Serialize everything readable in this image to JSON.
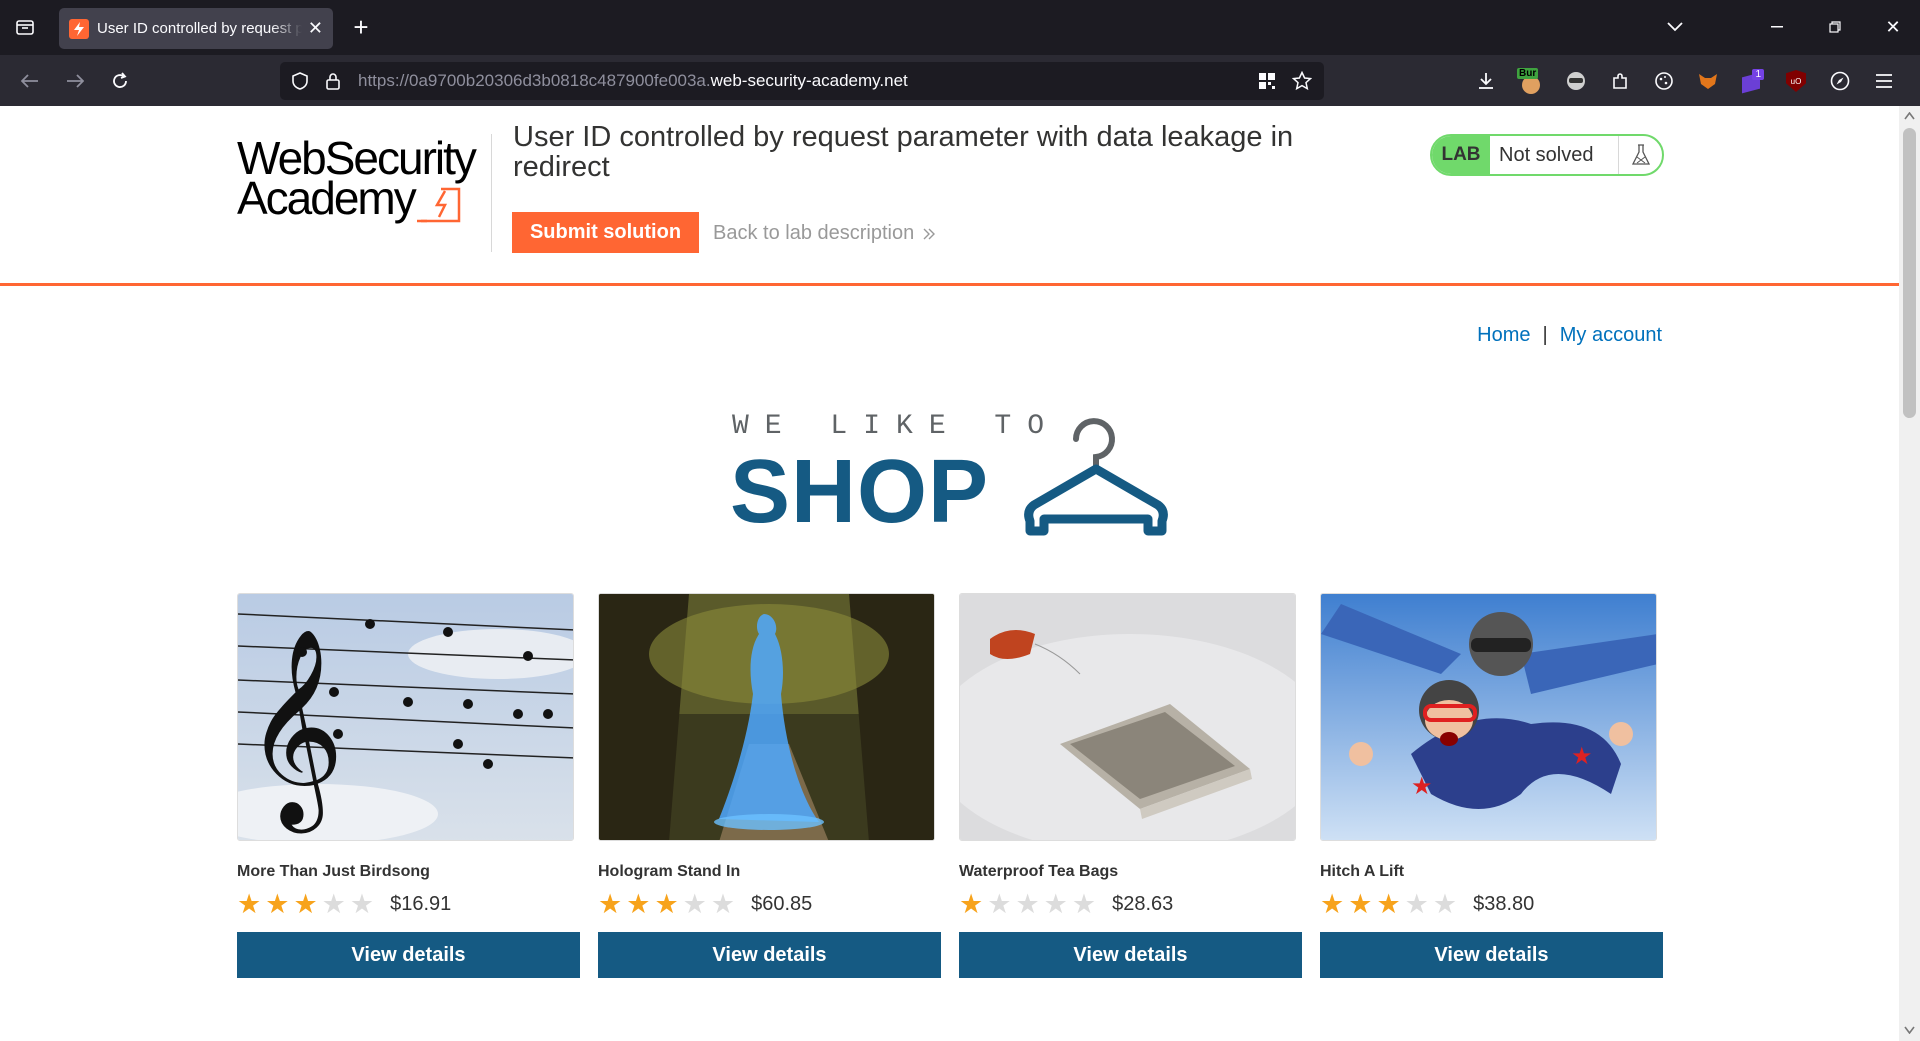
{
  "browser": {
    "tab_title": "User ID controlled by request parameter with data leakage in redirect",
    "url_prefix": "https://0a9700b20306d3b0818c487900fe003a.",
    "url_domain": "web-security-academy.net",
    "ext_badge_label": "Bur",
    "ext_count": "1",
    "ublock_label": "uO"
  },
  "lab": {
    "logo_line1": "WebSecurity",
    "logo_line2": "Academy",
    "title": "User ID controlled by request parameter with data leakage in redirect",
    "submit_label": "Submit solution",
    "back_label": "Back to lab description",
    "status_badge": "LAB",
    "status_text": "Not solved"
  },
  "nav": {
    "home": "Home",
    "separator": "|",
    "my_account": "My account"
  },
  "banner": {
    "line1": "WE LIKE TO",
    "line2": "SHOP"
  },
  "colors": {
    "accent": "#ff6633",
    "brand_blue": "#155a83",
    "link": "#0071bc",
    "star_on": "#f7a31c",
    "star_off": "#dcdcdc",
    "lab_green": "#70d96b"
  },
  "products": [
    {
      "name": "More Than Just Birdsong",
      "rating": 3,
      "price": "$16.91",
      "button": "View details",
      "image": "birds-on-music-staff"
    },
    {
      "name": "Hologram Stand In",
      "rating": 3,
      "price": "$60.85",
      "button": "View details",
      "image": "blue-hologram-woman"
    },
    {
      "name": "Waterproof Tea Bags",
      "rating": 1,
      "price": "$28.63",
      "button": "View details",
      "image": "tea-bag"
    },
    {
      "name": "Hitch A Lift",
      "rating": 3,
      "price": "$38.80",
      "button": "View details",
      "image": "skydivers"
    }
  ]
}
